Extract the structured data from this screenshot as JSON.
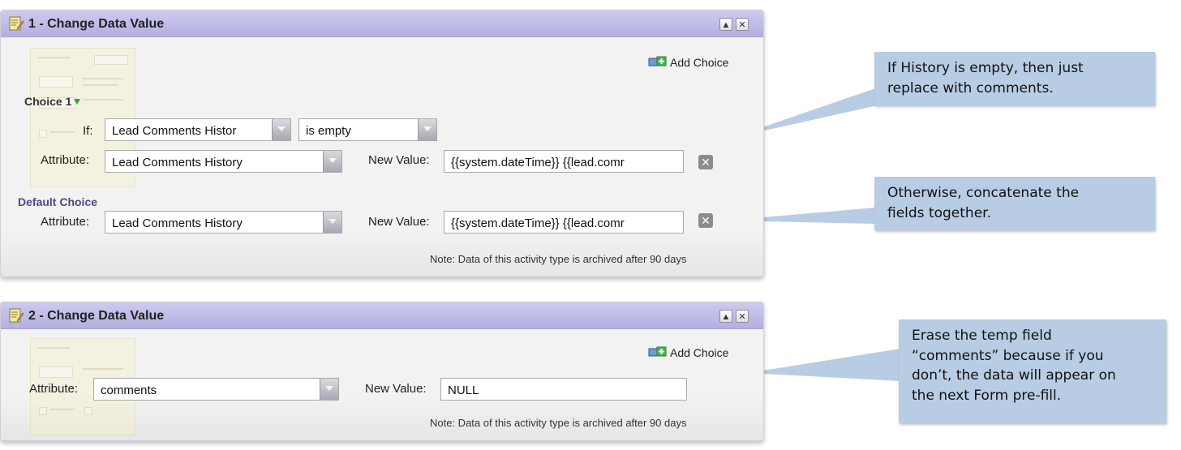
{
  "panels": [
    {
      "title": "1 - Change Data Value",
      "add_choice": "Add Choice",
      "choice_label": "Choice 1",
      "if_label": "If:",
      "if_field": "Lead Comments Histor",
      "if_operator": "is empty",
      "rows": [
        {
          "attribute_label": "Attribute:",
          "attribute": "Lead Comments History",
          "new_value_label": "New Value:",
          "new_value": "{{system.dateTime}} {{lead.comr"
        },
        {
          "attribute_label": "Attribute:",
          "attribute": "Lead Comments History",
          "new_value_label": "New Value:",
          "new_value": "{{system.dateTime}} {{lead.comr"
        }
      ],
      "default_choice": "Default Choice",
      "note": "Note: Data of this activity type is archived after 90 days"
    },
    {
      "title": "2 - Change Data Value",
      "add_choice": "Add Choice",
      "rows": [
        {
          "attribute_label": "Attribute:",
          "attribute": "comments",
          "new_value_label": "New Value:",
          "new_value": "NULL"
        }
      ],
      "note": "Note: Data of this activity type is archived after 90 days"
    }
  ],
  "callouts": [
    {
      "lines": [
        "If History is empty, then just",
        "replace with comments."
      ]
    },
    {
      "lines": [
        "Otherwise, concatenate the",
        "fields together."
      ]
    },
    {
      "lines": [
        "Erase the temp field",
        "“comments” because if you",
        "don’t, the data will appear on",
        "the next Form pre-fill."
      ]
    }
  ],
  "colors": {
    "header": "#b3afe0",
    "callout": "#b8cde4",
    "choice_arrow": "#3aa33a"
  },
  "icons": [
    "edit-document-icon",
    "collapse-icon",
    "close-icon",
    "add-choice-icon",
    "delete-icon",
    "choice-dropdown-icon"
  ]
}
